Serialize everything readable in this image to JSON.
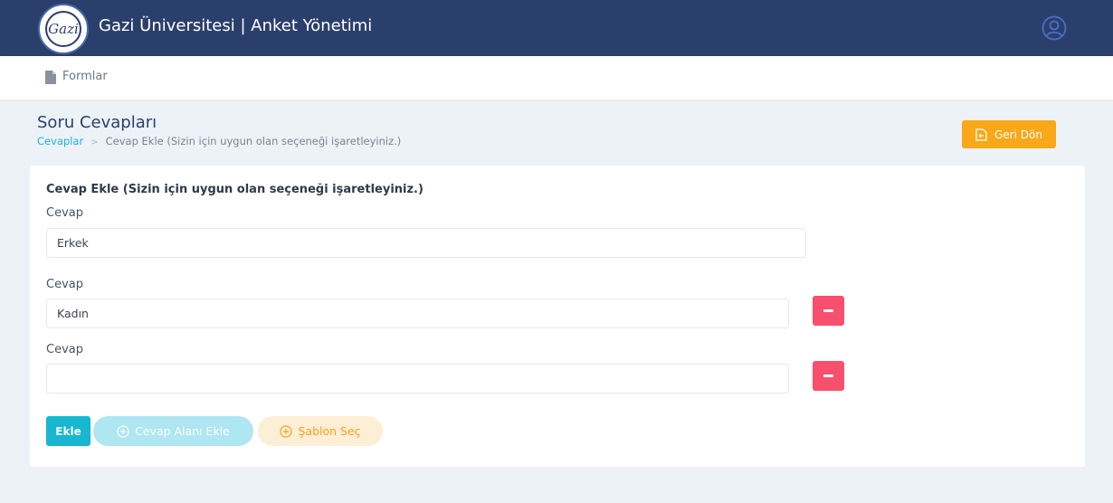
{
  "header": {
    "logo_text": "Gazi",
    "title": "Gazi Üniversitesi | Anket Yönetimi",
    "user_icon": "user-avatar-icon"
  },
  "nav": {
    "icon": "document-icon",
    "label": "Formlar"
  },
  "page": {
    "title": "Soru Cevapları",
    "breadcrumb": {
      "link": "Cevaplar",
      "separator": ">",
      "current": "Cevap Ekle (Sizin için uygun olan seçeneği işaretleyiniz.)"
    },
    "back_button": "Geri Dön"
  },
  "form": {
    "title": "Cevap Ekle (Sizin için uygun olan seçeneği işaretleyiniz.)",
    "fields": [
      {
        "label": "Cevap",
        "value": "Erkek"
      },
      {
        "label": "Cevap",
        "value": "Kadın"
      },
      {
        "label": "Cevap",
        "value": ""
      }
    ],
    "submit_label": "Ekle",
    "add_field_label": "Cevap Alanı Ekle",
    "template_label": "Şablon Seç"
  },
  "colors": {
    "header": "#2b3f6c",
    "accent_cyan": "#17b7cf",
    "warning": "#f8a818",
    "danger": "#f7506e"
  }
}
